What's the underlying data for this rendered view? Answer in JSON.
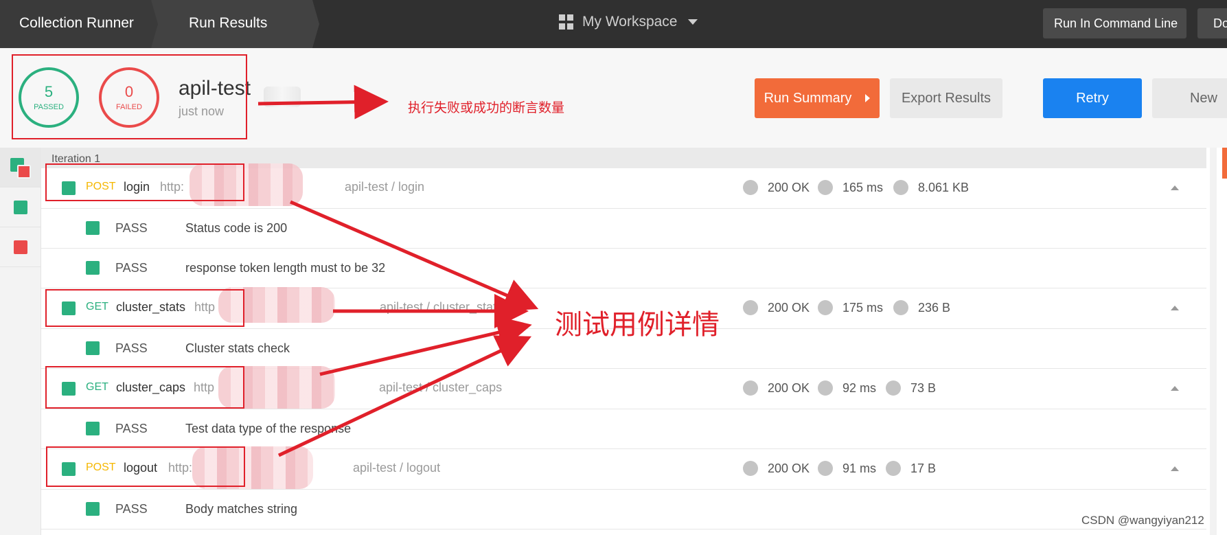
{
  "topbar": {
    "crumb_collection_runner": "Collection Runner",
    "crumb_run_results": "Run Results",
    "workspace": "My Workspace",
    "run_in_command_line": "Run In Command Line",
    "docs_partial": "Do"
  },
  "summary": {
    "passed_count": "5",
    "passed_label": "PASSED",
    "failed_count": "0",
    "failed_label": "FAILED",
    "run_name": "apil-test",
    "run_time": "just now",
    "run_summary_label": "Run Summary",
    "export_results_label": "Export Results",
    "retry_label": "Retry",
    "new_label": "New"
  },
  "iteration_label": "Iteration 1",
  "requests": [
    {
      "method": "POST",
      "name": "login",
      "url": "http:",
      "path": "apil-test / login",
      "status": "200 OK",
      "time": "165 ms",
      "size": "8.061 KB",
      "assertions": [
        {
          "result": "PASS",
          "name": "Status code is 200"
        },
        {
          "result": "PASS",
          "name": "response token length must to be 32"
        }
      ]
    },
    {
      "method": "GET",
      "name": "cluster_stats",
      "url": "http",
      "path": "apil-test / cluster_stats",
      "status": "200 OK",
      "time": "175 ms",
      "size": "236 B",
      "assertions": [
        {
          "result": "PASS",
          "name": "Cluster stats check"
        }
      ]
    },
    {
      "method": "GET",
      "name": "cluster_caps",
      "url": "http",
      "path": "apil-test / cluster_caps",
      "status": "200 OK",
      "time": "92 ms",
      "size": "73 B",
      "assertions": [
        {
          "result": "PASS",
          "name": "Test data type of the response"
        }
      ]
    },
    {
      "method": "POST",
      "name": "logout",
      "url": "http:",
      "path": "apil-test / logout",
      "status": "200 OK",
      "time": "91 ms",
      "size": "17 B",
      "assertions": [
        {
          "result": "PASS",
          "name": "Body matches string"
        }
      ]
    }
  ],
  "annotations": {
    "assert_count_note": "执行失败或成功的断言数量",
    "test_case_detail": "测试用例详情"
  },
  "watermark": "CSDN @wangyiyan212",
  "colors": {
    "pass_green": "#2bb07f",
    "fail_red": "#ea4a4a",
    "post_orange": "#f5b700",
    "get_green": "#2bb07f",
    "run_summary_orange": "#f26b3a",
    "retry_blue": "#1a82f0",
    "annotation_red": "#e0202a"
  }
}
